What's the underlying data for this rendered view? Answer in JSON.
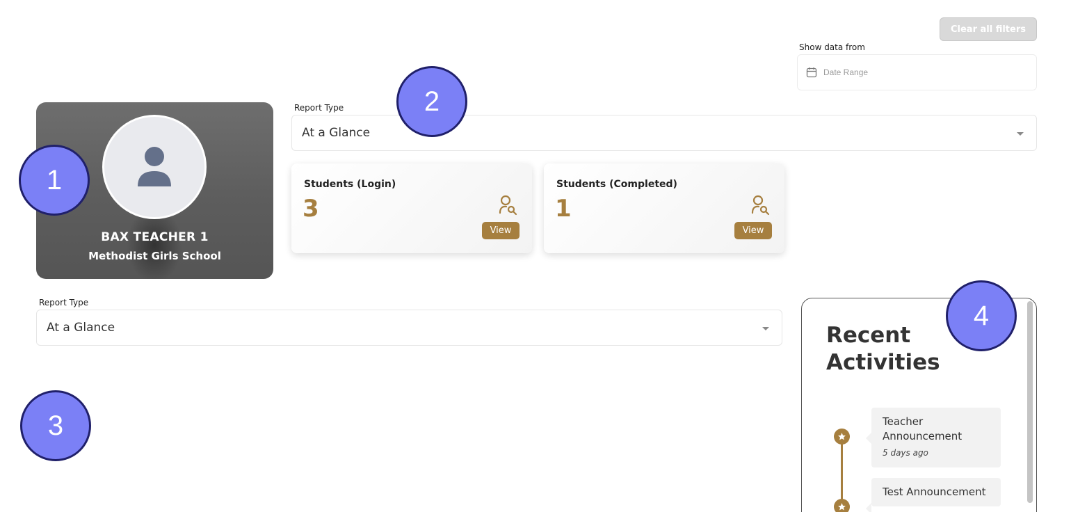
{
  "filters": {
    "clear_label": "Clear all filters",
    "show_data_label": "Show data from",
    "date_range_placeholder": "Date Range"
  },
  "profile": {
    "name": "BAX TEACHER 1",
    "school": "Methodist Girls School"
  },
  "report_type_top": {
    "label": "Report Type",
    "value": "At a Glance"
  },
  "stats": [
    {
      "title": "Students (Login)",
      "value": "3",
      "button": "View",
      "icon": "user-search-icon"
    },
    {
      "title": "Students (Completed)",
      "value": "1",
      "button": "View",
      "icon": "user-search-icon"
    }
  ],
  "report_type_bottom": {
    "label": "Report Type",
    "value": "At a Glance"
  },
  "activities": {
    "title": "Recent Activities",
    "items": [
      {
        "title": "Teacher Announcement",
        "time": "5 days ago",
        "icon": "star-icon"
      },
      {
        "title": "Test Announcement",
        "time": "",
        "icon": "star-icon"
      }
    ]
  },
  "badges": [
    "1",
    "2",
    "3",
    "4"
  ],
  "colors": {
    "accent": "#a67f3f",
    "badge": "#7b80f6",
    "badge_border": "#20206a",
    "profile_bg": "#626262"
  }
}
